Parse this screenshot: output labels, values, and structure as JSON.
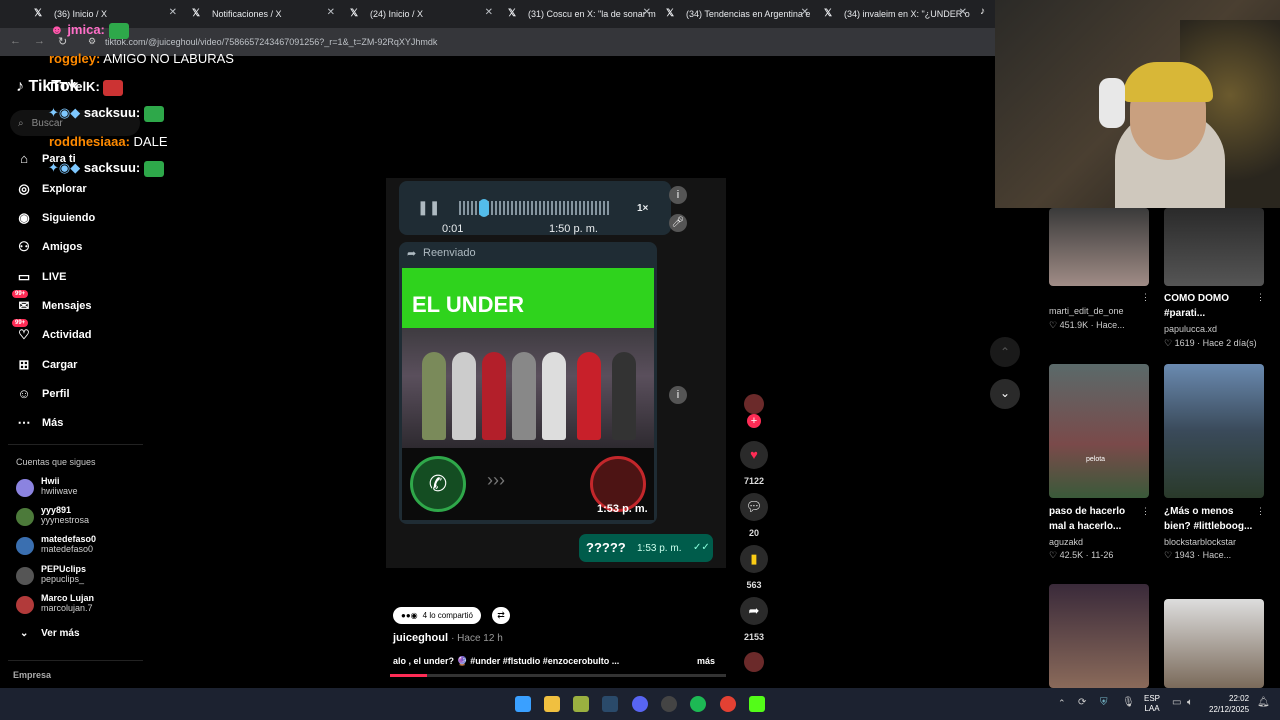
{
  "tabs": [
    {
      "label": "(36) Inicio / X"
    },
    {
      "label": "Notificaciones / X"
    },
    {
      "label": "(24) Inicio / X"
    },
    {
      "label": "(31) Coscu en X: \"la de sonar m"
    },
    {
      "label": "(34) Tendencias en Argentina e"
    },
    {
      "label": "(34) invaleim en X: \"¿UNDER o"
    }
  ],
  "address": {
    "url": "tiktok.com/@juiceghoul/video/7586657243467091256?_r=1&_t=ZM-92RqXYJhmdk"
  },
  "sidebar": {
    "logo": "TikTok",
    "search_placeholder": "Buscar",
    "nav": [
      {
        "label": "Para ti",
        "icon": "home-icon"
      },
      {
        "label": "Explorar",
        "icon": "compass-icon"
      },
      {
        "label": "Siguiendo",
        "icon": "following-icon"
      },
      {
        "label": "Amigos",
        "icon": "friends-icon"
      },
      {
        "label": "LIVE",
        "icon": "live-icon"
      },
      {
        "label": "Mensajes",
        "icon": "messages-icon",
        "badge": "99+"
      },
      {
        "label": "Actividad",
        "icon": "activity-icon",
        "badge": "99+"
      },
      {
        "label": "Cargar",
        "icon": "upload-icon"
      },
      {
        "label": "Perfil",
        "icon": "profile-icon"
      },
      {
        "label": "Más",
        "icon": "more-icon"
      }
    ],
    "following_title": "Cuentas que sigues",
    "following": [
      {
        "name": "Hwii",
        "handle": "hwiiwave"
      },
      {
        "name": "yyy891",
        "handle": "yyynestrosa"
      },
      {
        "name": "matedefaso0",
        "handle": "matedefaso0"
      },
      {
        "name": "PEPUclips",
        "handle": "pepuclips_"
      },
      {
        "name": "Marco Lujan",
        "handle": "marcolujan.7"
      }
    ],
    "ver_mas": "Ver más",
    "empresa": "Empresa"
  },
  "chat": [
    {
      "user": "jmica:",
      "text": ""
    },
    {
      "user": "roggley:",
      "text": "AMIGO NO LABURAS"
    },
    {
      "user": "TiTYelK:",
      "text": ""
    },
    {
      "user": "sacksuu:",
      "text": ""
    },
    {
      "user": "roddhesiaaa:",
      "text": "DALE"
    },
    {
      "user": "sacksuu:",
      "text": ""
    }
  ],
  "video": {
    "voice_time": "0:01",
    "voice_ts": "1:50 p. m.",
    "speed": "1×",
    "forwarded": "Reenviado",
    "under_text": "EL UNDER",
    "call_ts": "1:53 p. m.",
    "reply_text": "?????",
    "reply_ts": "1:53 p. m."
  },
  "actions": {
    "likes": "7122",
    "comments": "20",
    "saves": "563",
    "shares": "2153"
  },
  "post": {
    "shared_label": "4 lo compartió",
    "author": "juiceghoul",
    "time": "· Hace 12 h",
    "caption": "alo , el under? 🔮 #under #flstudio #enzocerobulto ...",
    "more": "más"
  },
  "recommendations": [
    {
      "title": "",
      "user": "marti_edit_de_one",
      "stats": "♡ 451.9K · Hace..."
    },
    {
      "title": "COMO DOMO #parati...",
      "user": "papulucca.xd",
      "stats": "♡ 1619 · Hace 2 día(s)"
    },
    {
      "title": "paso de hacerlo mal a hacerlo...",
      "user": "aguzakd",
      "stats": "♡ 42.5K · 11-26",
      "overlay": "pelota"
    },
    {
      "title": "¿Más o menos bien? #littleboog...",
      "user": "blockstarblockstar",
      "stats": "♡ 1943 · Hace..."
    },
    {
      "title": "",
      "user": "",
      "stats": ""
    },
    {
      "title": "",
      "user": "",
      "stats": ""
    }
  ],
  "taskbar": {
    "lang1": "ESP",
    "lang2": "LAA",
    "time": "22:02",
    "date": "22/12/2025"
  }
}
